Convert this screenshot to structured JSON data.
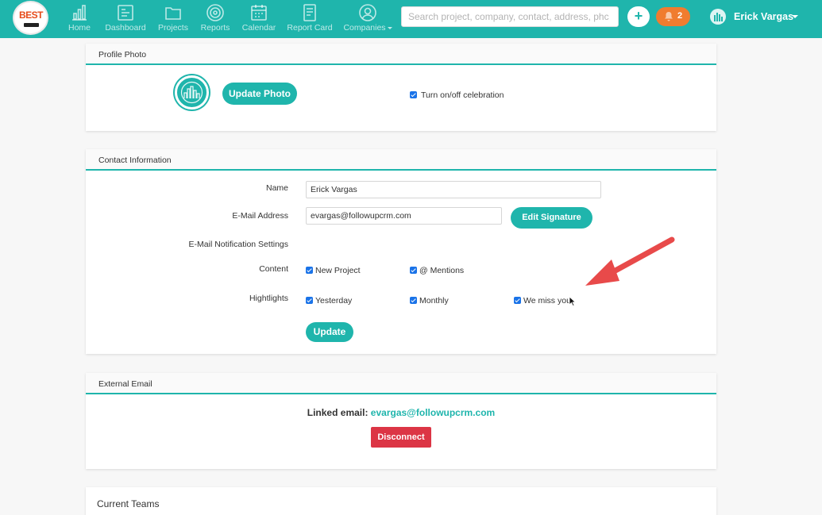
{
  "brand": {
    "logo_text": "BEST"
  },
  "nav": {
    "items": [
      {
        "label": "Home",
        "icon": "bar-chart-icon"
      },
      {
        "label": "Dashboard",
        "icon": "dashboard-icon"
      },
      {
        "label": "Projects",
        "icon": "folder-icon"
      },
      {
        "label": "Reports",
        "icon": "target-icon"
      },
      {
        "label": "Calendar",
        "icon": "calendar-icon"
      },
      {
        "label": "Report Card",
        "icon": "report-card-icon"
      },
      {
        "label": "Companies",
        "icon": "user-circle-icon"
      }
    ]
  },
  "search": {
    "placeholder": "Search project, company, contact, address, phc"
  },
  "header": {
    "add_label": "+",
    "notification_count": "2",
    "user_name": "Erick Vargas"
  },
  "profile_photo": {
    "title": "Profile Photo",
    "update_button": "Update Photo",
    "celebration_label": "Turn on/off celebration",
    "celebration_checked": true
  },
  "contact": {
    "title": "Contact Information",
    "name_label": "Name",
    "name_value": "Erick Vargas",
    "email_label": "E-Mail Address",
    "email_value": "evargas@followupcrm.com",
    "edit_signature": "Edit Signature",
    "notif_settings_label": "E-Mail Notification Settings",
    "content_label": "Content",
    "content_options": [
      {
        "label": "New Project",
        "checked": true
      },
      {
        "label": "@ Mentions",
        "checked": true
      }
    ],
    "highlights_label": "Hightlights",
    "highlight_options": [
      {
        "label": "Yesterday",
        "checked": true
      },
      {
        "label": "Monthly",
        "checked": true
      },
      {
        "label": "We miss you",
        "checked": true
      }
    ],
    "update_button": "Update"
  },
  "external_email": {
    "title": "External Email",
    "linked_label": "Linked email:",
    "linked_value": "evargas@followupcrm.com",
    "disconnect_button": "Disconnect"
  },
  "teams": {
    "title": "Current Teams"
  },
  "colors": {
    "brand_teal": "#1fb5ac",
    "danger": "#dc3545",
    "notification": "#f07c2f",
    "annotation_arrow": "#e84a4a"
  }
}
